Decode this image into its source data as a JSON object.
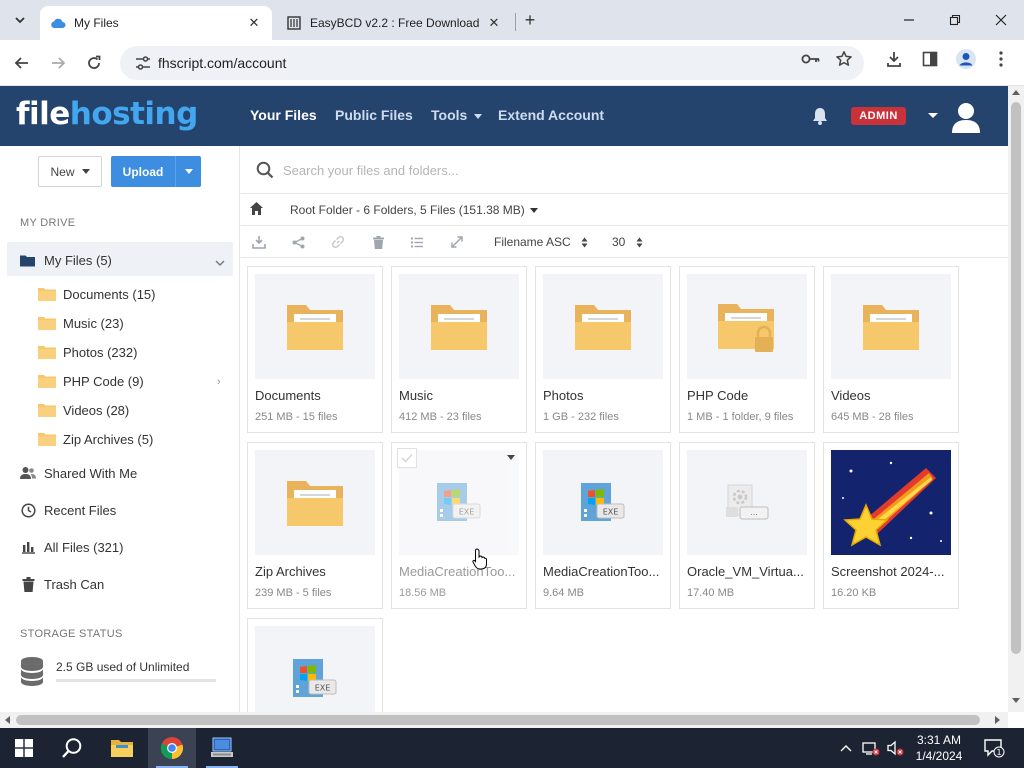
{
  "browser": {
    "tabs": [
      {
        "title": "My Files",
        "active": true
      },
      {
        "title": "EasyBCD v2.2 : Free Download",
        "active": false
      }
    ],
    "url": "fhscript.com/account"
  },
  "site": {
    "logo_part1": "file",
    "logo_part2": "hosting",
    "nav": [
      "Your Files",
      "Public Files",
      "Tools",
      "Extend Account"
    ],
    "role_badge": "ADMIN"
  },
  "sidebar": {
    "new_label": "New",
    "upload_label": "Upload",
    "drive_heading": "MY DRIVE",
    "my_files": "My Files (5)",
    "folders": [
      "Documents (15)",
      "Music (23)",
      "Photos (232)",
      "PHP Code (9)",
      "Videos (28)",
      "Zip Archives (5)"
    ],
    "links": [
      "Shared With Me",
      "Recent Files",
      "All Files (321)",
      "Trash Can"
    ],
    "storage_heading": "STORAGE STATUS",
    "storage_text": "2.5 GB used of Unlimited",
    "storage_used_fraction": 0
  },
  "main": {
    "search_placeholder": "Search your files and folders...",
    "breadcrumb": "Root Folder - 6 Folders, 5 Files (151.38 MB)",
    "sort_label": "Filename ASC",
    "per_page": "30",
    "items": [
      {
        "name": "Documents",
        "meta": "251 MB - 15 files",
        "kind": "folder"
      },
      {
        "name": "Music",
        "meta": "412 MB - 23 files",
        "kind": "folder"
      },
      {
        "name": "Photos",
        "meta": "1 GB - 232 files",
        "kind": "folder"
      },
      {
        "name": "PHP Code",
        "meta": "1 MB - 1 folder, 9 files",
        "kind": "folder-locked"
      },
      {
        "name": "Videos",
        "meta": "645 MB - 28 files",
        "kind": "folder"
      },
      {
        "name": "Zip Archives",
        "meta": "239 MB - 5 files",
        "kind": "folder"
      },
      {
        "name": "MediaCreationToo...",
        "meta": "18.56 MB",
        "kind": "exe"
      },
      {
        "name": "MediaCreationToo...",
        "meta": "9.64 MB",
        "kind": "exe"
      },
      {
        "name": "Oracle_VM_Virtua...",
        "meta": "17.40 MB",
        "kind": "installer"
      },
      {
        "name": "Screenshot 2024-...",
        "meta": "16.20 KB",
        "kind": "image"
      },
      {
        "name": "",
        "meta": "",
        "kind": "exe"
      }
    ],
    "exe_badge": "EXE"
  },
  "taskbar": {
    "time": "3:31 AM",
    "date": "1/4/2024",
    "notification_count": "1"
  },
  "colors": {
    "header_bg": "#24436d",
    "accent_blue": "#3d8ee0",
    "logo_accent": "#43a7f0",
    "admin_badge": "#c8323a",
    "folder": "#f6c86b"
  }
}
